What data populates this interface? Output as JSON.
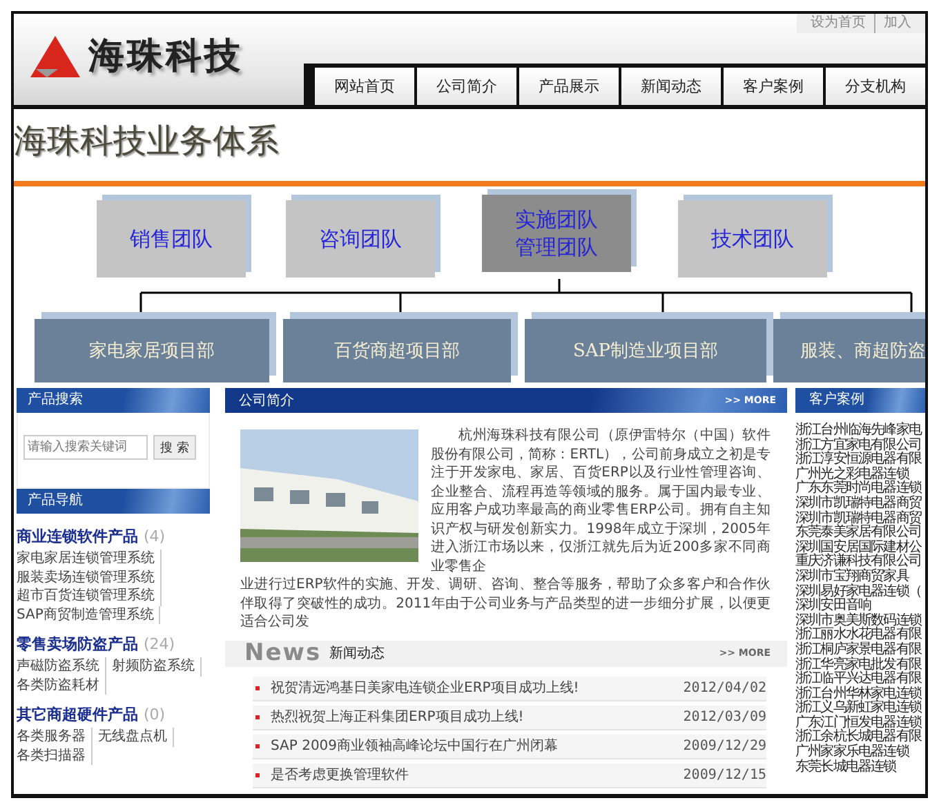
{
  "header": {
    "logo_text": "海珠科技",
    "top_links": [
      "设为首页",
      "加入"
    ],
    "nav": [
      "网站首页",
      "公司简介",
      "产品展示",
      "新闻动态",
      "客户案例",
      "分支机构"
    ]
  },
  "banner": {
    "title": "海珠科技业务体系",
    "teams": [
      {
        "lines": [
          "销售团队"
        ],
        "kind": "light"
      },
      {
        "lines": [
          "咨询团队"
        ],
        "kind": "light"
      },
      {
        "lines": [
          "实施团队",
          "管理团队"
        ],
        "kind": "dark"
      },
      {
        "lines": [
          "技术团队"
        ],
        "kind": "light"
      }
    ],
    "departments": [
      "家电家居项目部",
      "百货商超项目部",
      "SAP制造业项目部",
      "服装、商超防盗"
    ]
  },
  "search": {
    "title": "产品搜索",
    "placeholder": "请输入搜索关键词",
    "button": "搜 索"
  },
  "product_nav": {
    "title": "产品导航",
    "categories": [
      {
        "name": "商业连锁软件产品",
        "count": "(4)",
        "items": [
          "家电家居连锁管理系统",
          "服装卖场连锁管理系统",
          "超市百货连锁管理系统",
          "SAP商贸制造管理系统"
        ]
      },
      {
        "name": "零售卖场防盗产品",
        "count": "(24)",
        "items": [
          "声磁防盗系统",
          "射频防盗系统",
          "各类防盗耗材"
        ]
      },
      {
        "name": "其它商超硬件产品",
        "count": "(0)",
        "items": [
          "各类服务器",
          "无线盘点机",
          "各类扫描器"
        ]
      }
    ]
  },
  "intro": {
    "title": "公司简介",
    "more": ">> MORE",
    "text_beside_photo": "杭州海珠科技有限公司（原伊雷特尔（中国）软件股份有限公司，简称：ERTL），公司前身成立之初是专注于开发家电、家居、百货ERP以及行业性管理咨询、企业整合、流程再造等领域的服务。属于国内最专业、应用客户成功率最高的商业零售ERP公司。拥有自主知识产权与研发创新实力。1998年成立于深圳，2005年进入浙江市场以来，仅浙江就先后为近200多家不同商业零售企",
    "text_below_photo": "业进行过ERP软件的实施、开发、调研、咨询、整合等服务，帮助了众多客户和合作伙伴取得了突破性的成功。2011年由于公司业务与产品类型的进一步细分扩展，以便更适合公司发"
  },
  "news": {
    "logo": "News",
    "title": "新闻动态",
    "more": ">> MORE",
    "items": [
      {
        "title": "祝贺清远鸿基日美家电连锁企业ERP项目成功上线!",
        "date": "2012/04/02"
      },
      {
        "title": "热烈祝贺上海正科集团ERP项目成功上线!",
        "date": "2012/03/09"
      },
      {
        "title": "SAP 2009商业领袖高峰论坛中国行在广州闭幕",
        "date": "2009/12/29"
      },
      {
        "title": "是否考虑更换管理软件",
        "date": "2009/12/15"
      }
    ]
  },
  "customers": {
    "title": "客户案例",
    "items": [
      "浙江台州临海先峰家电",
      "浙江方宜家电有限公司",
      "浙江淳安恒源电器有限",
      "广州光之彩电器连锁",
      "广东东莞时尚电器连锁",
      "深圳市凯瑞特电器商贸",
      "深圳市凯瑞特电器商贸",
      "东莞泰美家居有限公司",
      "深圳国安居国际建材公",
      "重庆济谦科技有限公司",
      "深圳市宝翔商贸家具",
      "深圳易好家电器连锁（",
      "深圳安田音响",
      "深圳市奥美斯数码连锁",
      "浙江丽水水花电器有限",
      "浙江桐庐家景电器有限",
      "浙江华亮家电批发有限",
      "浙江临平兴达电器有限",
      "浙江台州华林家电连锁",
      "浙江义乌新虹家电连锁",
      "广东江门恒发电器连锁",
      "浙江余杭长城电器有限",
      "广州家家乐电器连锁",
      "东莞长城电器连锁"
    ]
  }
}
